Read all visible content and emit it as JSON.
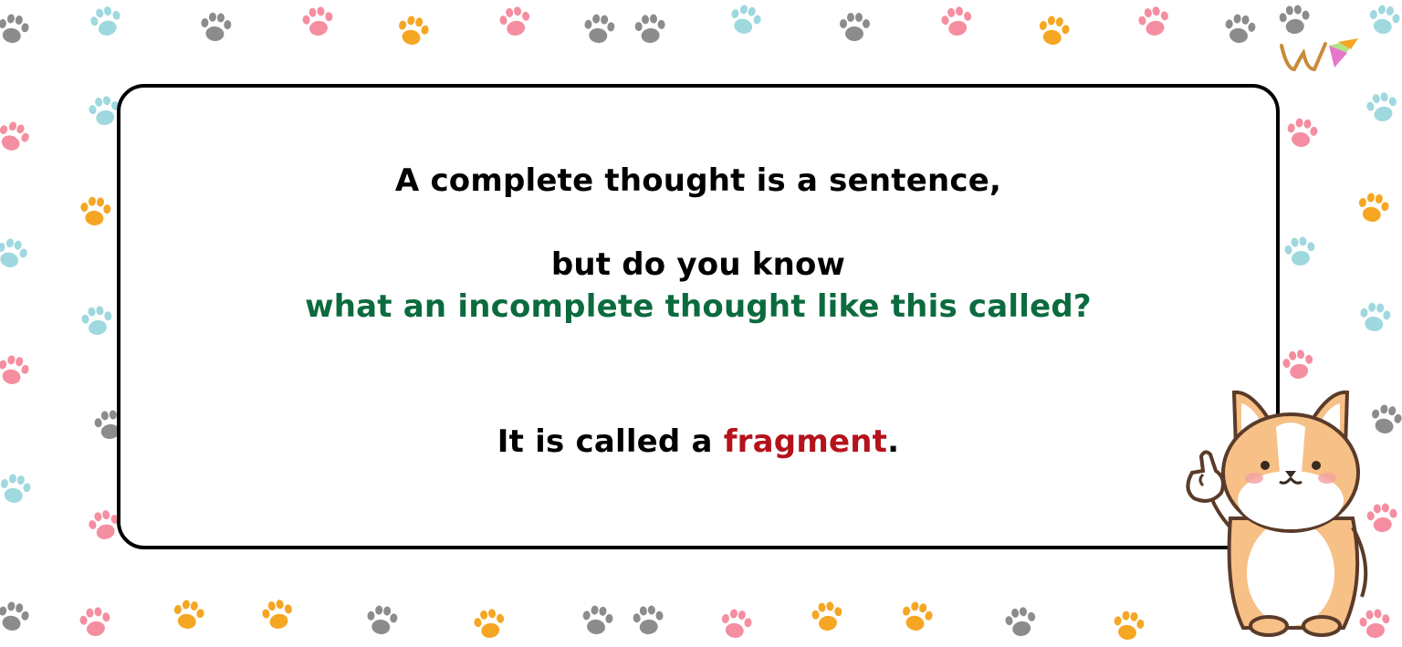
{
  "colors": {
    "question_accent": "#0b6b3e",
    "answer_accent": "#b5121b",
    "paw_palette": [
      "#8c8c8c",
      "#9fd8df",
      "#f58ea0",
      "#f5a623"
    ]
  },
  "card": {
    "line1": "A complete thought is a sentence,",
    "line2": "but do you know",
    "line3": "what an incomplete thought like this called?",
    "line4_prefix": "It is called a ",
    "line4_answer": "fragment",
    "line4_suffix": "."
  },
  "decorations": {
    "background_icon": "paw-print-icon",
    "logo_icon": "w-logo-icon",
    "mascot_icon": "corgi-mascot-icon"
  }
}
